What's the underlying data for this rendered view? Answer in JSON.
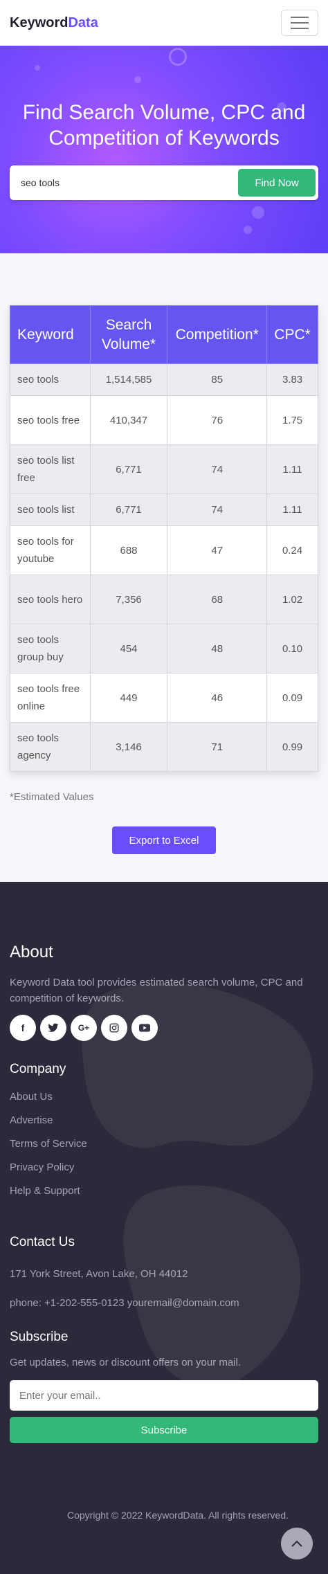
{
  "header": {
    "brand_part1": "Keyword",
    "brand_part2": "Data"
  },
  "hero": {
    "title": "Find Search Volume, CPC and Competition of Keywords",
    "search_value": "seo tools",
    "button_label": "Find Now"
  },
  "table": {
    "headers": [
      "Keyword",
      "Search Volume*",
      "Competition*",
      "CPC*"
    ],
    "rows": [
      [
        "seo tools",
        "1,514,585",
        "85",
        "3.83"
      ],
      [
        "seo tools free",
        "410,347",
        "76",
        "1.75"
      ],
      [
        "seo tools list free",
        "6,771",
        "74",
        "1.11"
      ],
      [
        "seo tools list",
        "6,771",
        "74",
        "1.11"
      ],
      [
        "seo tools for youtube",
        "688",
        "47",
        "0.24"
      ],
      [
        "seo tools hero",
        "7,356",
        "68",
        "1.02"
      ],
      [
        "seo tools group buy",
        "454",
        "48",
        "0.10"
      ],
      [
        "seo tools free online",
        "449",
        "46",
        "0.09"
      ],
      [
        "seo tools agency",
        "3,146",
        "71",
        "0.99"
      ]
    ]
  },
  "note": "*Estimated Values",
  "export_label": "Export to Excel",
  "footer": {
    "about_title": "About",
    "about_text": "Keyword Data tool provides estimated search volume, CPC and competition of keywords.",
    "socials": [
      "facebook-icon",
      "twitter-icon",
      "google-plus-icon",
      "instagram-icon",
      "youtube-icon"
    ],
    "company_title": "Company",
    "company_links": [
      "About Us",
      "Advertise",
      "Terms of Service",
      "Privacy Policy",
      "Help & Support"
    ],
    "contact_title": "Contact Us",
    "address": "171 York Street, Avon Lake, OH 44012",
    "phone_email": "phone: +1-202-555-0123 youremail@domain.com",
    "subscribe_title": "Subscribe",
    "subscribe_text": "Get updates, news or discount offers on your mail.",
    "email_placeholder": "Enter your email..",
    "subscribe_label": "Subscribe",
    "copyright": "Copyright © 2022 KeywordData. All rights reserved."
  }
}
